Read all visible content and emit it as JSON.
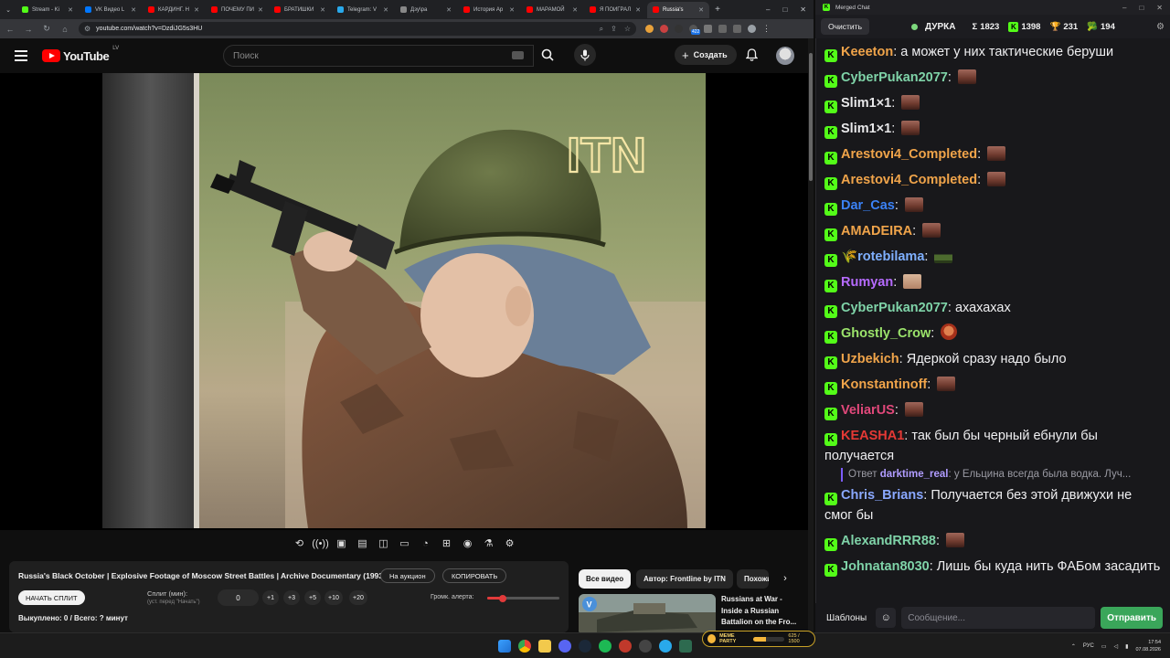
{
  "browser": {
    "tabs": [
      {
        "label": "Stream - Ki",
        "fav": "#53fc18",
        "active": false
      },
      {
        "label": "VK Видео L",
        "fav": "#0077ff",
        "active": false
      },
      {
        "label": "КАРДИНГ. Н",
        "fav": "#ff0000",
        "active": false
      },
      {
        "label": "ПОЧЕМУ ПИ",
        "fav": "#ff0000",
        "active": false
      },
      {
        "label": "БРАТИШКИ",
        "fav": "#ff0000",
        "active": false
      },
      {
        "label": "Telegram: V",
        "fav": "#29a9eb",
        "active": false
      },
      {
        "label": "Дзу\\ра",
        "fav": "#888888",
        "active": false
      },
      {
        "label": "История Ар",
        "fav": "#ff0000",
        "active": false
      },
      {
        "label": "МАРАМОЙ",
        "fav": "#ff0000",
        "active": false
      },
      {
        "label": "Я ПОИГРАЛ",
        "fav": "#ff0000",
        "active": false
      },
      {
        "label": "Russia's",
        "fav": "#ff0000",
        "active": true
      }
    ],
    "url": "youtube.com/watch?v=DzdiJG5s3HU",
    "ext_badge": "422"
  },
  "youtube": {
    "logo_text": "YouTube",
    "region": "LV",
    "search_placeholder": "Поиск",
    "create_label": "Создать"
  },
  "video": {
    "watermark": "ITN"
  },
  "panel": {
    "title": "Russia's Black October | Explosive Footage of Moscow Street Battles | Archive Documentary (1993)",
    "auction_label": "На аукцион",
    "copy_label": "КОПИРОВАТЬ",
    "start_split_label": "НАЧАТЬ СПЛИТ",
    "split_label": "Сплит (мин):",
    "split_hint": "(уст. перед \"Начать\")",
    "split_value": "0",
    "steps": [
      "+1",
      "+3",
      "+5",
      "+10",
      "+20"
    ],
    "alert_volume_label": "Громк. алерта:",
    "alert_volume_level": 0.22,
    "bought_line": "Выкуплено: 0 / Всего: ? минут"
  },
  "related": {
    "chips": [
      "Все видео",
      "Автор: Frontline by ITN",
      "Похожие"
    ],
    "video_title": "Russians at War - Inside a Russian Battalion on the Fro..."
  },
  "taskbar": {
    "lang": "РУС",
    "time": "17:54",
    "date": "07.08.2026",
    "meme_label": "MEME PARTY",
    "meme_progress": "625 / 1500",
    "meme_fill": 0.42
  },
  "chat": {
    "window_title": "Merged Chat",
    "clear_label": "Очистить",
    "channel": "ДУРКА",
    "stats": [
      {
        "icon": "sigma-icon",
        "symbol": "Σ",
        "value": "1823"
      },
      {
        "icon": "kick-icon",
        "symbol": "K",
        "value": "1398"
      },
      {
        "icon": "trophy-icon",
        "symbol": "🏆",
        "value": "231"
      },
      {
        "icon": "broccoli-icon",
        "symbol": "🥦",
        "value": "194"
      }
    ],
    "messages": [
      {
        "user": "Keeeton",
        "color": "#f0a44a",
        "text": "а может у них тактические беруши",
        "emote": ""
      },
      {
        "user": "CyberPukan2077",
        "color": "#7fd3a8",
        "text": "",
        "emote": "normal"
      },
      {
        "user": "Slim1×1",
        "color": "#e8e8ea",
        "text": "",
        "emote": "normal"
      },
      {
        "user": "Slim1×1",
        "color": "#e8e8ea",
        "text": "",
        "emote": "normal"
      },
      {
        "user": "Arestovi4_Completed",
        "color": "#f0a44a",
        "text": "",
        "emote": "normal"
      },
      {
        "user": "Arestovi4_Completed",
        "color": "#f0a44a",
        "text": "",
        "emote": "normal"
      },
      {
        "user": "Dar_Cas",
        "color": "#3b82f6",
        "text": "",
        "emote": "normal"
      },
      {
        "user": "AMADEIRA",
        "color": "#f0a44a",
        "text": "",
        "emote": "normal"
      },
      {
        "user": "rotebilama",
        "color": "#7fb0ff",
        "text": "",
        "emote": "tank",
        "badge": "🌾"
      },
      {
        "user": "Rumyan",
        "color": "#b66bff",
        "text": "",
        "emote": "face"
      },
      {
        "user": "CyberPukan2077",
        "color": "#7fd3a8",
        "text": "ахахахах",
        "emote": ""
      },
      {
        "user": "Ghostly_Crow",
        "color": "#9be36b",
        "text": "",
        "emote": "red"
      },
      {
        "user": "Uzbekich",
        "color": "#f0a44a",
        "text": "Ядеркой сразу надо было",
        "emote": ""
      },
      {
        "user": "Konstantinoff",
        "color": "#f0a44a",
        "text": "",
        "emote": "normal"
      },
      {
        "user": "VeliarUS",
        "color": "#e0487a",
        "text": "",
        "emote": "normal"
      },
      {
        "user": "KEASHA1",
        "color": "#e53935",
        "text": "так был бы черный ебнули бы получается",
        "emote": ""
      },
      {
        "reply_prefix": "Ответ",
        "reply_user": "darktime_real",
        "reply_text": "у Ельцина всегда была водка. Луч..."
      },
      {
        "user": "Chris_Brians",
        "color": "#8aa8ff",
        "text": "Получается без этой движухи не смог бы",
        "emote": ""
      },
      {
        "user": "AlexandRRR88",
        "color": "#7fd3a8",
        "text": "",
        "emote": "normal"
      },
      {
        "user": "Johnatan8030",
        "color": "#7fd3a8",
        "text": "Лишь бы куда нить ФАБом засадить",
        "emote": ""
      }
    ],
    "templates_label": "Шаблоны",
    "input_placeholder": "Сообщение...",
    "send_label": "Отправить"
  }
}
